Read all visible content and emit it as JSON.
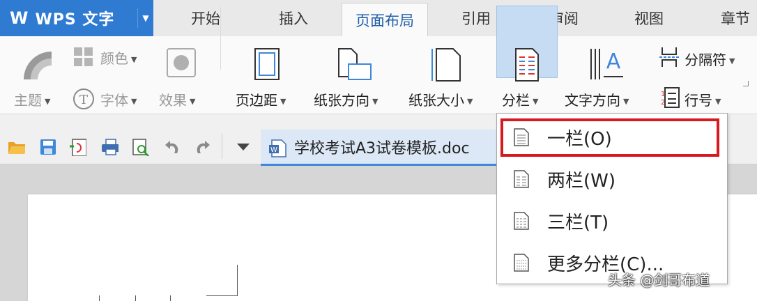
{
  "app": {
    "logo": "W",
    "title": "WPS 文字"
  },
  "tabs": [
    "开始",
    "插入",
    "页面布局",
    "引用",
    "审阅",
    "视图",
    "章节"
  ],
  "active_tab": "页面布局",
  "ribbon": {
    "theme": "主题",
    "color": "颜色",
    "font": "字体",
    "effect": "效果",
    "margin": "页边距",
    "orientation": "纸张方向",
    "size": "纸张大小",
    "columns": "分栏",
    "text_direction": "文字方向",
    "page_break": "分隔符",
    "line_number": "行号"
  },
  "document": {
    "tab_name": "学校考试A3试卷模板.doc"
  },
  "columns_menu": {
    "items": [
      "一栏(O)",
      "两栏(W)",
      "三栏(T)",
      "更多分栏(C)..."
    ],
    "highlighted_index": 0
  },
  "watermark": "头条 @剑哥布道",
  "colors": {
    "accent": "#2f7bd2",
    "highlight": "#d71920",
    "selected_btn": "#c5dcf3"
  }
}
